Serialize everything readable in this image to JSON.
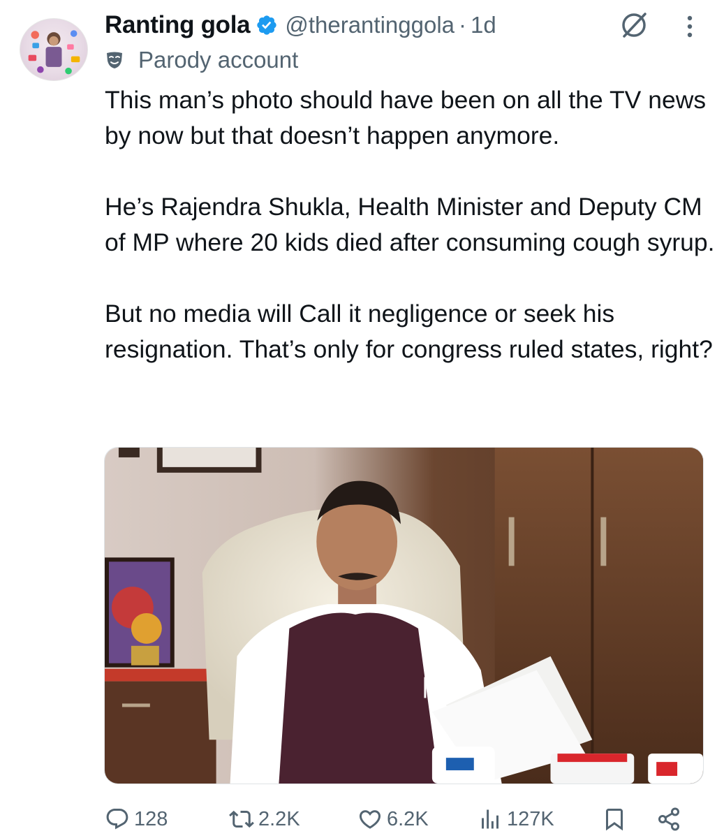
{
  "tweet": {
    "author": {
      "display_name": "Ranting gola",
      "handle": "@therantinggola",
      "verified": true,
      "label": "Parody account"
    },
    "separator": "·",
    "timestamp": "1d",
    "text_paragraphs": [
      "This man’s photo should have been on all the TV news by now but that doesn’t happen anymore.",
      "He’s Rajendra Shukla, Health Minister and Deputy CM of MP where 20 kids died after consuming cough syrup.",
      "But no media will Call it negligence or seek his resignation. That’s only for congress ruled states, right?"
    ],
    "metrics": {
      "replies": "128",
      "reposts": "2.2K",
      "likes": "6.2K",
      "views": "127K"
    }
  },
  "icons": {
    "verified": "verified-badge-icon",
    "grok": "grok-icon",
    "more": "more-icon",
    "parody": "mask-icon",
    "reply": "reply-icon",
    "repost": "repost-icon",
    "like": "heart-icon",
    "views": "views-icon",
    "bookmark": "bookmark-icon",
    "share": "share-icon"
  },
  "colors": {
    "text": "#0f1419",
    "secondary": "#536471",
    "verified_blue": "#1d9bf0"
  }
}
